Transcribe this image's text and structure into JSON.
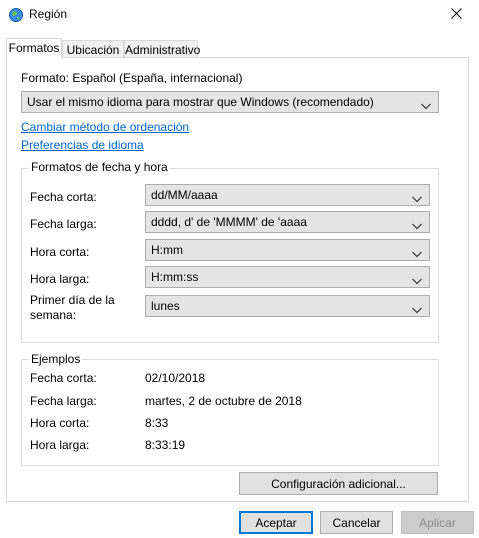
{
  "window": {
    "title": "Región"
  },
  "tabs": [
    {
      "label": "Formatos"
    },
    {
      "label": "Ubicación"
    },
    {
      "label": "Administrativo"
    }
  ],
  "format": {
    "label": "Formato: Español (España, internacional)",
    "dropdown_value": "Usar el mismo idioma para mostrar que Windows (recomendado)",
    "link_sort": "Cambiar método de ordenación",
    "link_lang": "Preferencias de idioma"
  },
  "date_formats": {
    "group_title": "Formatos de fecha y hora",
    "rows": [
      {
        "label": "Fecha corta:",
        "value": "dd/MM/aaaa"
      },
      {
        "label": "Fecha larga:",
        "value": "dddd, d' de 'MMMM' de 'aaaa"
      },
      {
        "label": "Hora corta:",
        "value": "H:mm"
      },
      {
        "label": "Hora larga:",
        "value": "H:mm:ss"
      },
      {
        "label_line1": "Primer día de la",
        "label_line2": "semana:",
        "value": "lunes"
      }
    ]
  },
  "examples": {
    "group_title": "Ejemplos",
    "rows": [
      {
        "label": "Fecha corta:",
        "value": "02/10/2018"
      },
      {
        "label": "Fecha larga:",
        "value": "martes, 2 de octubre de 2018"
      },
      {
        "label": "Hora corta:",
        "value": "8:33"
      },
      {
        "label": "Hora larga:",
        "value": "8:33:19"
      }
    ]
  },
  "buttons": {
    "additional": "Configuración adicional...",
    "ok": "Aceptar",
    "cancel": "Cancelar",
    "apply": "Aplicar"
  },
  "colors": {
    "link": "#0066cc",
    "default_button_border": "#0078d7"
  },
  "icons": [
    "globe-icon",
    "close-icon",
    "chevron-down-icon"
  ]
}
